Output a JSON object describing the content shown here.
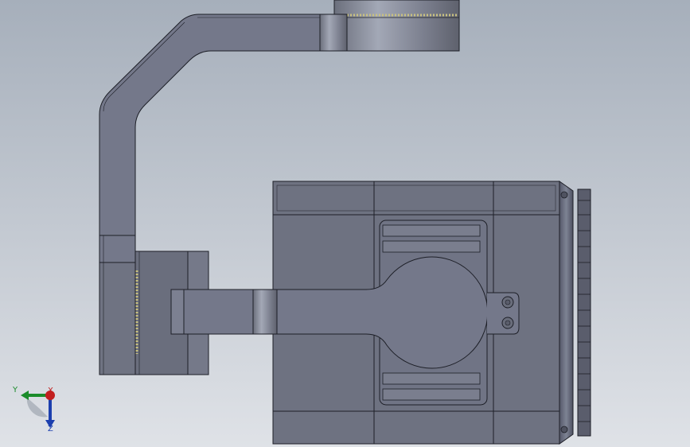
{
  "viewport": {
    "name": "cad-model-viewport",
    "background_top": "#aeb6c1",
    "background_bottom": "#dde1e6",
    "model_dark": "#6f7380",
    "model_mid": "#7c8190",
    "model_light": "#9a9fae",
    "edge_color": "#1d1f27",
    "thread_color": "#c8c080"
  },
  "triad": {
    "x_label": "X",
    "y_label": "Y",
    "z_label": "Z",
    "y_color": "#1b8c2b",
    "z_color": "#1c3fae",
    "x_color": "#c21f1f"
  }
}
